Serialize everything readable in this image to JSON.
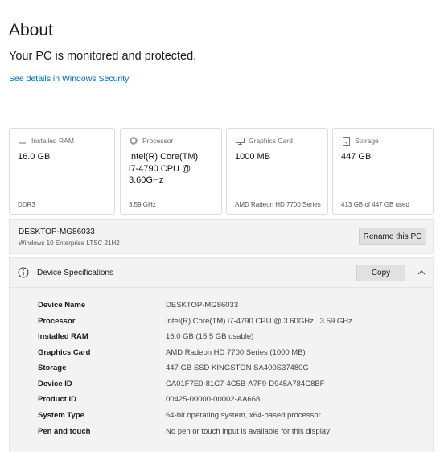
{
  "page": {
    "title": "About",
    "protection_status": "Your PC is monitored and protected.",
    "security_link": "See details in Windows Security"
  },
  "cards": [
    {
      "label": "Installed RAM",
      "value": "16.0 GB",
      "footer": "DDR3",
      "icon": "ram-icon"
    },
    {
      "label": "Processor",
      "value": "Intel(R) Core(TM) i7-4790 CPU @ 3.60GHz",
      "footer": "3.59 GHz",
      "icon": "processor-icon"
    },
    {
      "label": "Graphics Card",
      "value": "1000 MB",
      "footer": "AMD Radeon HD 7700 Series",
      "icon": "graphics-card-icon"
    },
    {
      "label": "Storage",
      "value": "447 GB",
      "footer": "413 GB of 447 GB used",
      "icon": "storage-icon"
    }
  ],
  "pc": {
    "name": "DESKTOP-MG86033",
    "edition": "Windows 10 Enterprise LTSC 21H2",
    "rename_button": "Rename this PC"
  },
  "specs": {
    "heading": "Device Specifications",
    "copy_button": "Copy",
    "rows": [
      {
        "key": "Device Name",
        "value": "DESKTOP-MG86033"
      },
      {
        "key": "Processor",
        "value": "Intel(R) Core(TM) i7-4790 CPU @ 3.60GHz   3.59 GHz"
      },
      {
        "key": "Installed RAM",
        "value": "16.0 GB (15.5 GB usable)"
      },
      {
        "key": "Graphics Card",
        "value": "AMD Radeon HD 7700 Series (1000 MB)"
      },
      {
        "key": "Storage",
        "value": "447 GB SSD KINGSTON SA400S37480G"
      },
      {
        "key": "Device ID",
        "value": "CA01F7E0-81C7-4C5B-A7F9-D945A784C8BF"
      },
      {
        "key": "Product ID",
        "value": "00425-00000-00002-AA668"
      },
      {
        "key": "System Type",
        "value": "64-bit operating system, x64-based processor"
      },
      {
        "key": "Pen and touch",
        "value": "No pen or touch input is available for this display"
      }
    ]
  },
  "colors": {
    "link": "#0067c0",
    "panel_bg": "#f3f3f3",
    "button_bg": "#e1e1e1"
  }
}
